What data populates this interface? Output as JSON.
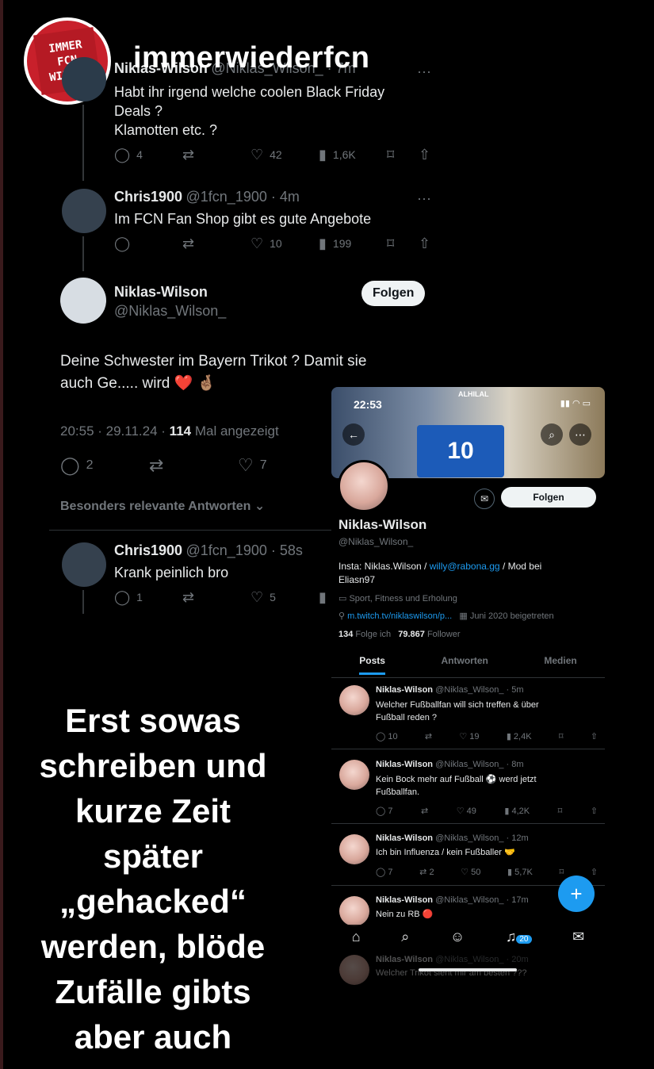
{
  "overlay": {
    "logo_lines": [
      "IMMER",
      "FCN",
      "WIEDER"
    ],
    "brand": "immerwiederfcn",
    "caption_lines": [
      "Erst sowas",
      "schreiben und",
      "kurze Zeit",
      "später",
      "„gehacked“",
      "werden, blöde",
      "Zufälle gibts",
      "aber auch"
    ]
  },
  "tweet1": {
    "name": "Niklas-Wilson",
    "handle": "@Niklas_Wilson_ · 7m",
    "text_lines": [
      "Habt ihr irgend welche coolen Black Friday",
      "Deals ?",
      "Klamotten etc. ?"
    ],
    "replies": "4",
    "likes": "42",
    "views": "1,6K"
  },
  "tweet2": {
    "name": "Chris1900",
    "handle": "@1fcn_1900 · 4m",
    "text": "Im FCN Fan Shop gibt es gute Angebote",
    "likes": "10",
    "views": "199"
  },
  "main_tweet": {
    "name": "Niklas-Wilson",
    "handle": "@Niklas_Wilson_",
    "follow": "Folgen",
    "text_lines": [
      "Deine Schwester im Bayern Trikot ?  Damit sie",
      "auch Ge..... wird ❤️ 🤞🏽"
    ],
    "timestamp": "20:55 · 29.11.24 · ",
    "view_count": "114",
    "view_label": " Mal angezeigt",
    "replies": "2",
    "likes": "7",
    "relevant": "Besonders relevante Antworten"
  },
  "reply": {
    "name": "Chris1900",
    "handle": "@1fcn_1900 · 58s",
    "text": "Krank peinlich bro",
    "replies": "1",
    "likes": "5"
  },
  "profile": {
    "status_time": "22:53",
    "jersey": "10",
    "banner_label": "ALHILAL",
    "follow": "Folgen",
    "name": "Niklas-Wilson",
    "handle": "@Niklas_Wilson_",
    "bio_prefix": "Insta: Niklas.Wilson / ",
    "bio_link": "willy@rabona.gg",
    "bio_suffix": " / Mod bei",
    "bio_line2": "Eliasn97",
    "category": "Sport, Fitness und Erholung",
    "website": "m.twitch.tv/niklaswilson/p...",
    "joined": "Juni 2020 beigetreten",
    "following_count": "134",
    "following_label": "Folge ich",
    "followers_count": "79.867",
    "followers_label": "Follower",
    "tabs": [
      "Posts",
      "Antworten",
      "Medien"
    ],
    "posts": [
      {
        "name": "Niklas-Wilson",
        "meta": "@Niklas_Wilson_ · 5m",
        "lines": [
          "Welcher Fußballfan will sich treffen & über",
          "Fußball reden ?"
        ],
        "replies": "10",
        "retweets": "",
        "likes": "19",
        "views": "2,4K"
      },
      {
        "name": "Niklas-Wilson",
        "meta": "@Niklas_Wilson_ · 8m",
        "lines": [
          "Kein Bock mehr auf Fußball ⚽ werd jetzt",
          "Fußballfan."
        ],
        "replies": "7",
        "retweets": "",
        "likes": "49",
        "views": "4,2K"
      },
      {
        "name": "Niklas-Wilson",
        "meta": "@Niklas_Wilson_ · 12m",
        "lines": [
          "Ich bin Influenza / kein Fußballer 🤝"
        ],
        "replies": "7",
        "retweets": "2",
        "likes": "50",
        "views": "5,7K"
      },
      {
        "name": "Niklas-Wilson",
        "meta": "@Niklas_Wilson_ · 17m",
        "lines": [
          "Nein zu RB 🔴"
        ],
        "replies": "",
        "retweets": "",
        "likes": "",
        "views": ""
      }
    ],
    "notification_badge": "20",
    "faded_name": "Niklas-Wilson",
    "faded_meta": "@Niklas_Wilson_ · 20m",
    "faded_text": "Welcher Trikot sieht mir am besten ???"
  }
}
